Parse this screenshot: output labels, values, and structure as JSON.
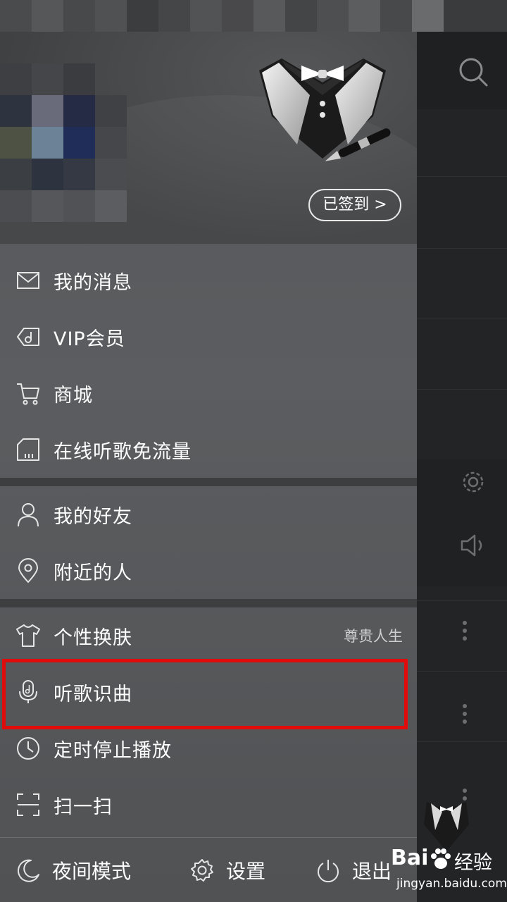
{
  "header": {
    "checkin_label": "已签到 >"
  },
  "menu": {
    "group1": [
      {
        "label": "我的消息",
        "icon": "mail-icon"
      },
      {
        "label": "VIP会员",
        "icon": "vip-tag-icon"
      },
      {
        "label": "商城",
        "icon": "cart-icon"
      },
      {
        "label": "在线听歌免流量",
        "icon": "sim-card-icon"
      }
    ],
    "group2": [
      {
        "label": "我的好友",
        "icon": "person-icon"
      },
      {
        "label": "附近的人",
        "icon": "location-pin-icon"
      }
    ],
    "group3": [
      {
        "label": "个性换肤",
        "icon": "tshirt-icon",
        "extra": "尊贵人生"
      },
      {
        "label": "听歌识曲",
        "icon": "mic-music-icon"
      },
      {
        "label": "定时停止播放",
        "icon": "clock-icon"
      },
      {
        "label": "扫一扫",
        "icon": "scan-icon"
      }
    ]
  },
  "bottom": {
    "night_mode": "夜间模式",
    "settings": "设置",
    "exit": "退出"
  },
  "watermark": {
    "brand": "Bai",
    "brand2": "经验",
    "url": "jingyan.baidu.com"
  },
  "colors": {
    "highlight": "#e00b0b",
    "drawer_bg": "#57595c",
    "background": "#232426"
  }
}
